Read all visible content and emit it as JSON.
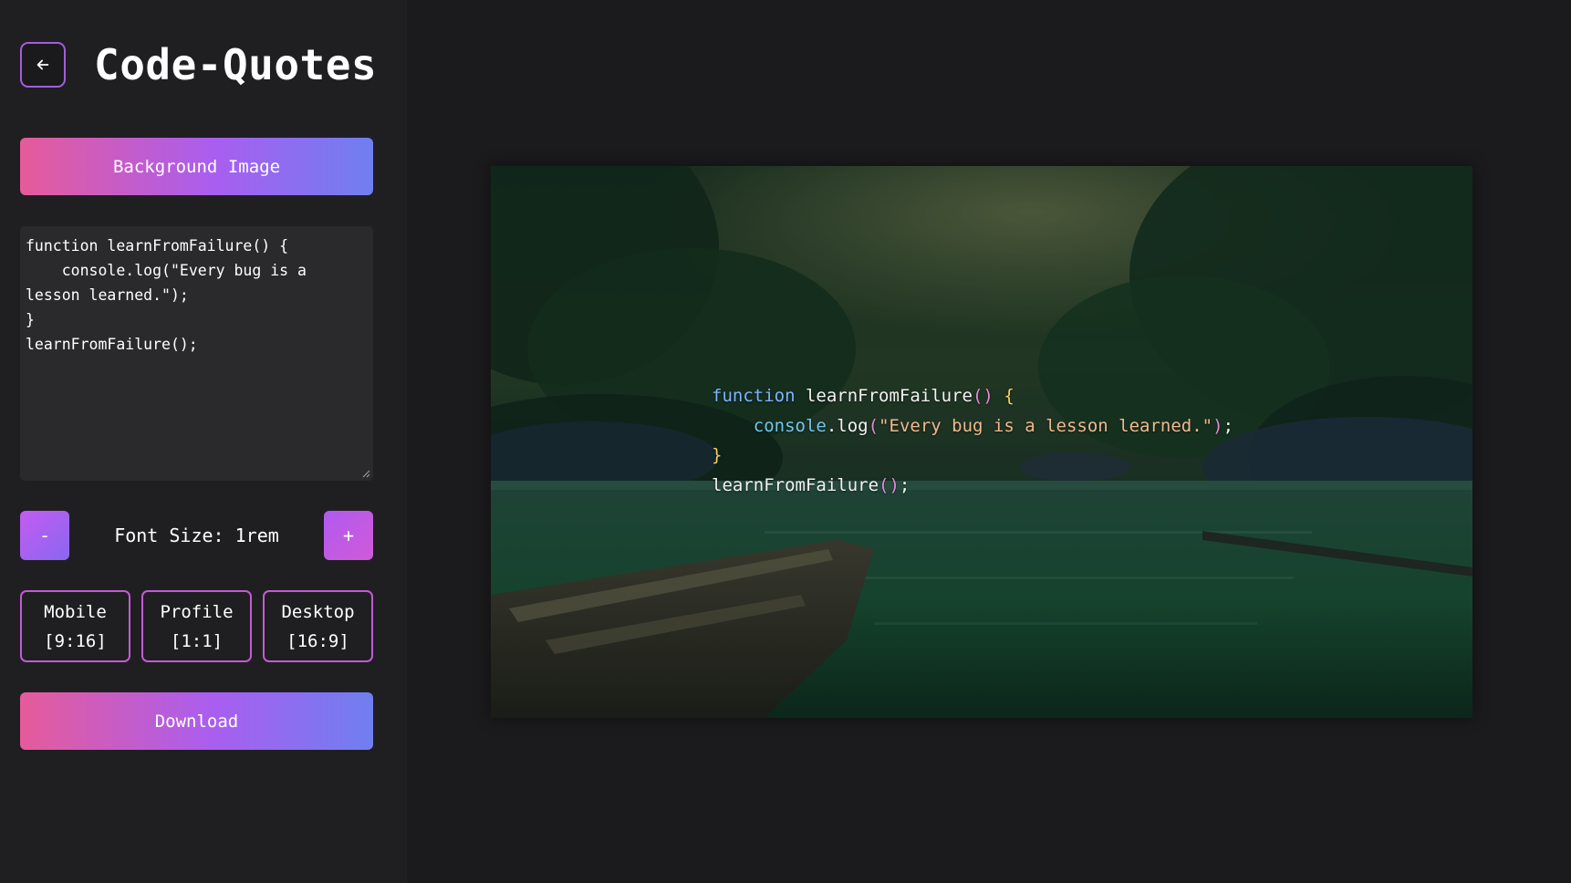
{
  "app": {
    "title": "Code-Quotes"
  },
  "header": {
    "back_icon": "arrow-left-icon"
  },
  "sidebar": {
    "background_button_label": "Background Image",
    "code_text": "function learnFromFailure() {\n    console.log(\"Every bug is a lesson learned.\");\n}\nlearnFromFailure();",
    "font_size": {
      "decrease_label": "-",
      "label": "Font Size: 1rem",
      "increase_label": "+"
    },
    "ratios": [
      {
        "name": "Mobile",
        "ratio": "[9:16]"
      },
      {
        "name": "Profile",
        "ratio": "[1:1]"
      },
      {
        "name": "Desktop",
        "ratio": "[16:9]"
      }
    ],
    "download_label": "Download"
  },
  "preview": {
    "code_lines": [
      [
        {
          "t": "function",
          "c": "kw"
        },
        {
          "t": " learnFromFailure",
          "c": "fn"
        },
        {
          "t": "()",
          "c": "paren"
        },
        {
          "t": " {",
          "c": "brace"
        }
      ],
      [
        {
          "t": "    ",
          "c": "fn"
        },
        {
          "t": "console",
          "c": "obj"
        },
        {
          "t": ".log",
          "c": "fn"
        },
        {
          "t": "(",
          "c": "paren"
        },
        {
          "t": "\"Every bug is a lesson learned.\"",
          "c": "str"
        },
        {
          "t": ")",
          "c": "paren"
        },
        {
          "t": ";",
          "c": "fn"
        }
      ],
      [
        {
          "t": "}",
          "c": "brace"
        }
      ],
      [
        {
          "t": "learnFromFailure",
          "c": "fn"
        },
        {
          "t": "()",
          "c": "paren"
        },
        {
          "t": ";",
          "c": "fn"
        }
      ]
    ]
  },
  "colors": {
    "accent_pink": "#e65b9a",
    "accent_purple": "#a95ef0",
    "accent_blue": "#6f7ff0",
    "background": "#1b1b1d",
    "sidebar": "#1f1f22"
  }
}
